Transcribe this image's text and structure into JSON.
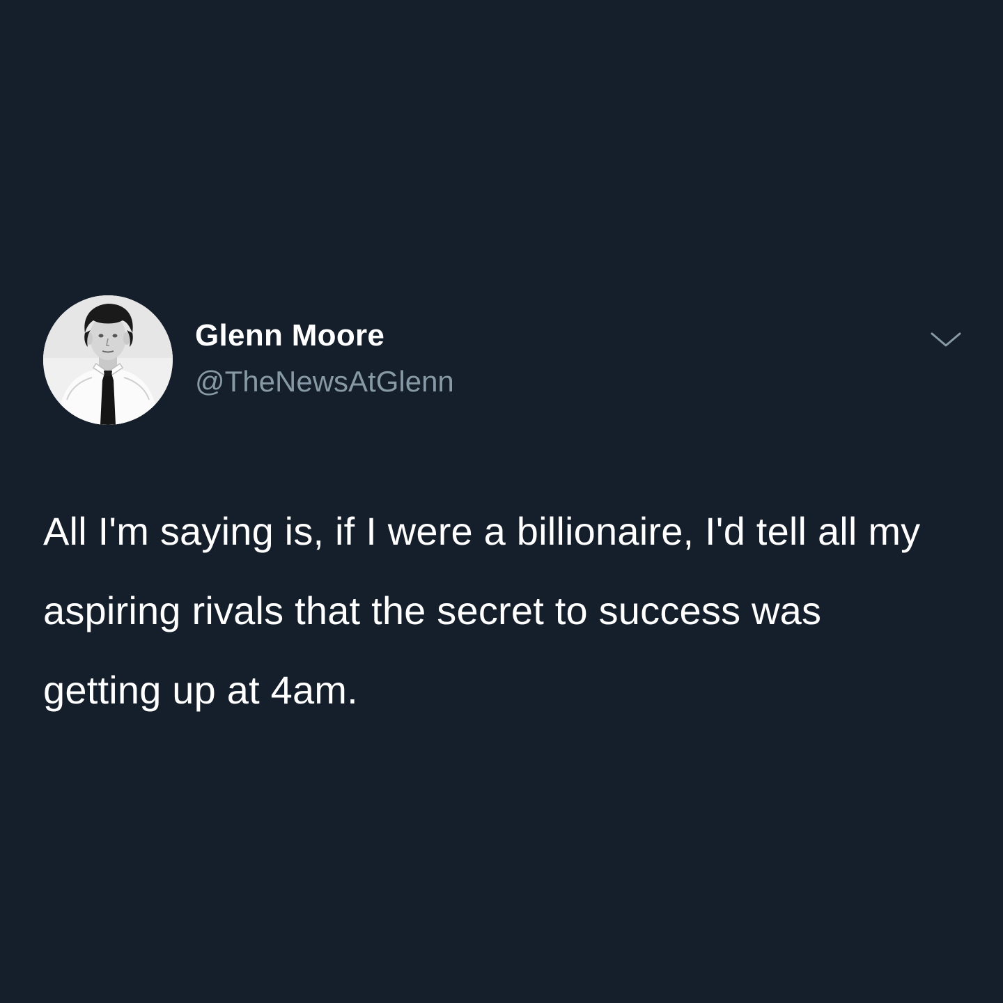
{
  "tweet": {
    "author": {
      "display_name": "Glenn Moore",
      "handle": "@TheNewsAtGlenn",
      "avatar": "avatar-photo-icon"
    },
    "menu_icon": "chevron-down-icon",
    "text": "All I'm saying is, if I were a billionaire, I'd tell all my aspiring rivals that the secret to success was getting up at 4am."
  },
  "colors": {
    "background": "#151e2b",
    "text_primary": "#ffffff",
    "text_secondary": "#8899a6"
  }
}
